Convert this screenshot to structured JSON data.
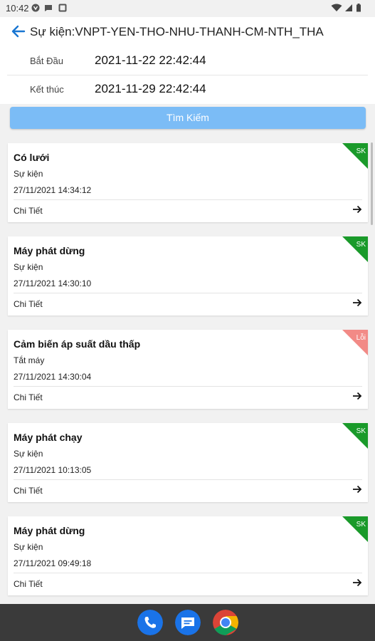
{
  "status": {
    "time": "10:42"
  },
  "header": {
    "title": "Sự kiện:VNPT-YEN-THO-NHU-THANH-CM-NTH_THA"
  },
  "filters": {
    "start_label": "Bắt Đầu",
    "start_value": "2021-11-22 22:42:44",
    "end_label": "Kết thúc",
    "end_value": "2021-11-29 22:42:44"
  },
  "search_label": "Tìm Kiếm",
  "colors": {
    "accent": "#1976d2",
    "search": "#7bbcf6",
    "ok_tag": "#1a9a2a",
    "error_tag": "#f28a86"
  },
  "items": [
    {
      "title": "Có lưới",
      "type": "Sự kiện",
      "time": "27/11/2021 14:34:12",
      "detail": "Chi Tiết",
      "tag": "SK"
    },
    {
      "title": "Máy phát dừng",
      "type": "Sự kiện",
      "time": "27/11/2021 14:30:10",
      "detail": "Chi Tiết",
      "tag": "SK"
    },
    {
      "title": "Cảm biến áp suất dầu thấp",
      "type": "Tắt máy",
      "time": "27/11/2021 14:30:04",
      "detail": "Chi Tiết",
      "tag": "Lỗi"
    },
    {
      "title": "Máy phát chạy",
      "type": "Sự kiện",
      "time": "27/11/2021 10:13:05",
      "detail": "Chi Tiết",
      "tag": "SK"
    },
    {
      "title": "Máy phát dừng",
      "type": "Sự kiện",
      "time": "27/11/2021 09:49:18",
      "detail": "Chi Tiết",
      "tag": "SK"
    }
  ],
  "dock": [
    {
      "icon": "phone-icon"
    },
    {
      "icon": "messages-icon"
    },
    {
      "icon": "chrome-icon"
    }
  ]
}
